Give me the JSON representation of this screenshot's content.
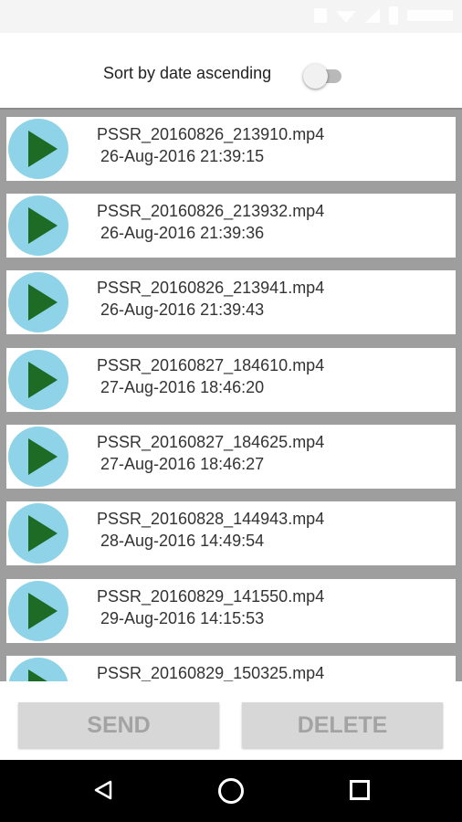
{
  "status_bar": {
    "icons": [
      "notification-icon",
      "wifi-icon",
      "signal-icon",
      "battery-icon"
    ]
  },
  "sort": {
    "label": "Sort by date ascending",
    "enabled": false
  },
  "files": [
    {
      "name": "PSSR_20160826_213910.mp4",
      "date": "26-Aug-2016 21:39:15"
    },
    {
      "name": "PSSR_20160826_213932.mp4",
      "date": "26-Aug-2016 21:39:36"
    },
    {
      "name": "PSSR_20160826_213941.mp4",
      "date": "26-Aug-2016 21:39:43"
    },
    {
      "name": "PSSR_20160827_184610.mp4",
      "date": "27-Aug-2016 18:46:20"
    },
    {
      "name": "PSSR_20160827_184625.mp4",
      "date": "27-Aug-2016 18:46:27"
    },
    {
      "name": "PSSR_20160828_144943.mp4",
      "date": "28-Aug-2016 14:49:54"
    },
    {
      "name": "PSSR_20160829_141550.mp4",
      "date": "29-Aug-2016 14:15:53"
    },
    {
      "name": "PSSR_20160829_150325.mp4",
      "date": ""
    }
  ],
  "actions": {
    "send_label": "SEND",
    "delete_label": "DELETE"
  },
  "colors": {
    "play_circle": "#8fd3e8",
    "play_triangle": "#1e6b26",
    "list_background": "#9e9e9e",
    "button_background": "#d7d7d7",
    "button_text": "#a3a3a3"
  },
  "nav_bar": {
    "icons": [
      "back-icon",
      "home-icon",
      "recents-icon"
    ]
  }
}
